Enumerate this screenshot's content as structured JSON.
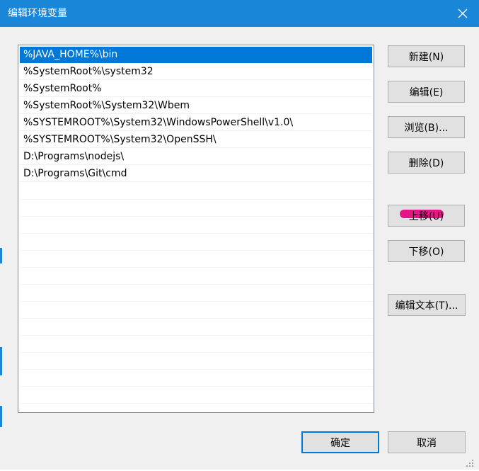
{
  "window": {
    "title": "编辑环境变量",
    "close_icon": "close-icon"
  },
  "path_list": {
    "items": [
      {
        "value": "%JAVA_HOME%\\bin",
        "selected": true
      },
      {
        "value": "%SystemRoot%\\system32",
        "selected": false
      },
      {
        "value": "%SystemRoot%",
        "selected": false
      },
      {
        "value": "%SystemRoot%\\System32\\Wbem",
        "selected": false
      },
      {
        "value": "%SYSTEMROOT%\\System32\\WindowsPowerShell\\v1.0\\",
        "selected": false
      },
      {
        "value": "%SYSTEMROOT%\\System32\\OpenSSH\\",
        "selected": false
      },
      {
        "value": "D:\\Programs\\nodejs\\",
        "selected": false
      },
      {
        "value": "D:\\Programs\\Git\\cmd",
        "selected": false
      }
    ]
  },
  "side_buttons": {
    "new": "新建(N)",
    "edit": "编辑(E)",
    "browse": "浏览(B)...",
    "delete": "删除(D)",
    "move_up": "上移(U)",
    "move_down": "下移(O)",
    "edit_text": "编辑文本(T)..."
  },
  "footer_buttons": {
    "ok": "确定",
    "cancel": "取消"
  },
  "colors": {
    "titlebar": "#1a86d8",
    "selection": "#0078d7",
    "annotation_mark": "#e4007c"
  }
}
